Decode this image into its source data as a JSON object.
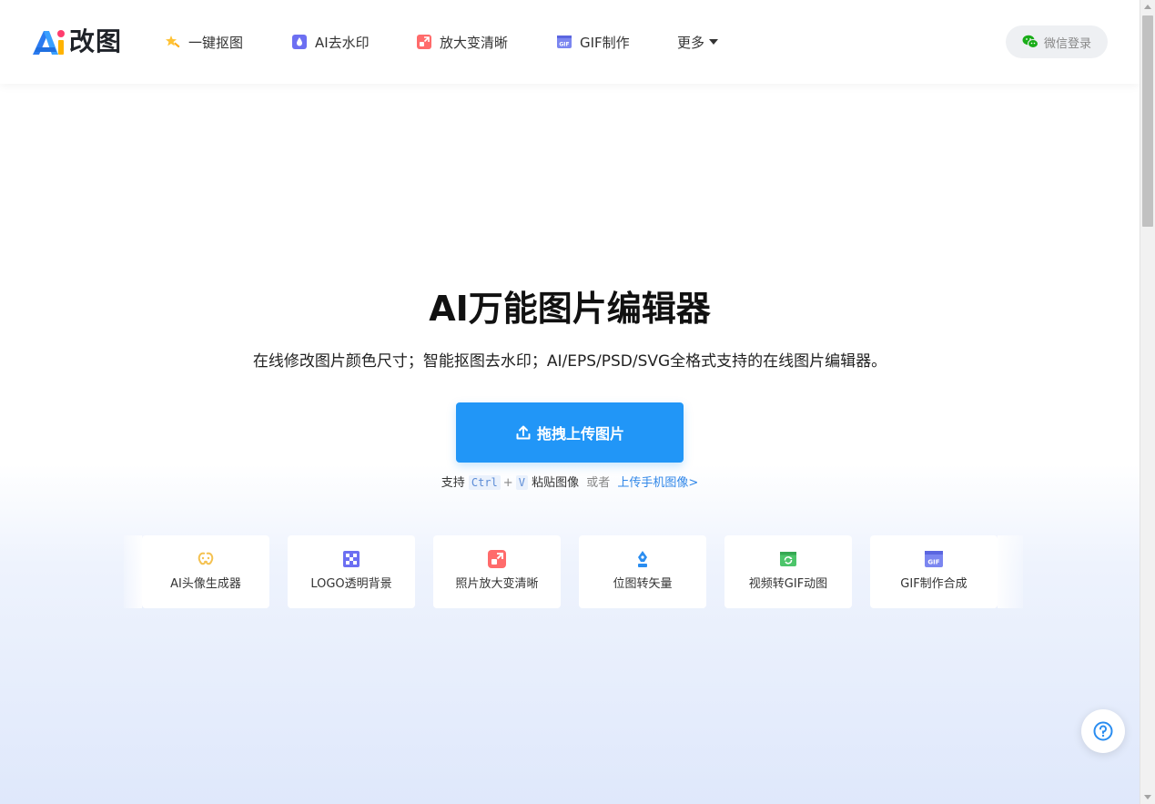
{
  "header": {
    "logo_text": "改图",
    "nav": [
      {
        "label": "一键抠图",
        "icon": "magic-star-icon"
      },
      {
        "label": "AI去水印",
        "icon": "water-drop-icon"
      },
      {
        "label": "放大变清晰",
        "icon": "enlarge-icon"
      },
      {
        "label": "GIF制作",
        "icon": "gif-icon"
      }
    ],
    "more_label": "更多",
    "login_label": "微信登录"
  },
  "hero": {
    "title": "AI万能图片编辑器",
    "subtitle": "在线修改图片颜色尺寸；智能抠图去水印；AI/EPS/PSD/SVG全格式支持的在线图片编辑器。",
    "upload_label": "拖拽上传图片",
    "paste_prefix": "支持",
    "key_ctrl": "Ctrl",
    "key_plus": "+",
    "key_v": "V",
    "paste_suffix": "粘贴图像",
    "or_text": "或者",
    "mobile_link": "上传手机图像>"
  },
  "tools": [
    {
      "label": "AI头像生成器",
      "icon": "ai-avatar-icon"
    },
    {
      "label": "LOGO透明背景",
      "icon": "transparent-checker-icon"
    },
    {
      "label": "照片放大变清晰",
      "icon": "enlarge-icon"
    },
    {
      "label": "位图转矢量",
      "icon": "pen-nib-icon"
    },
    {
      "label": "视频转GIF动图",
      "icon": "video-convert-icon"
    },
    {
      "label": "GIF制作合成",
      "icon": "gif-icon"
    }
  ],
  "colors": {
    "primary": "#2196f7",
    "link": "#2f86e8",
    "wechat_green": "#1aad19"
  }
}
